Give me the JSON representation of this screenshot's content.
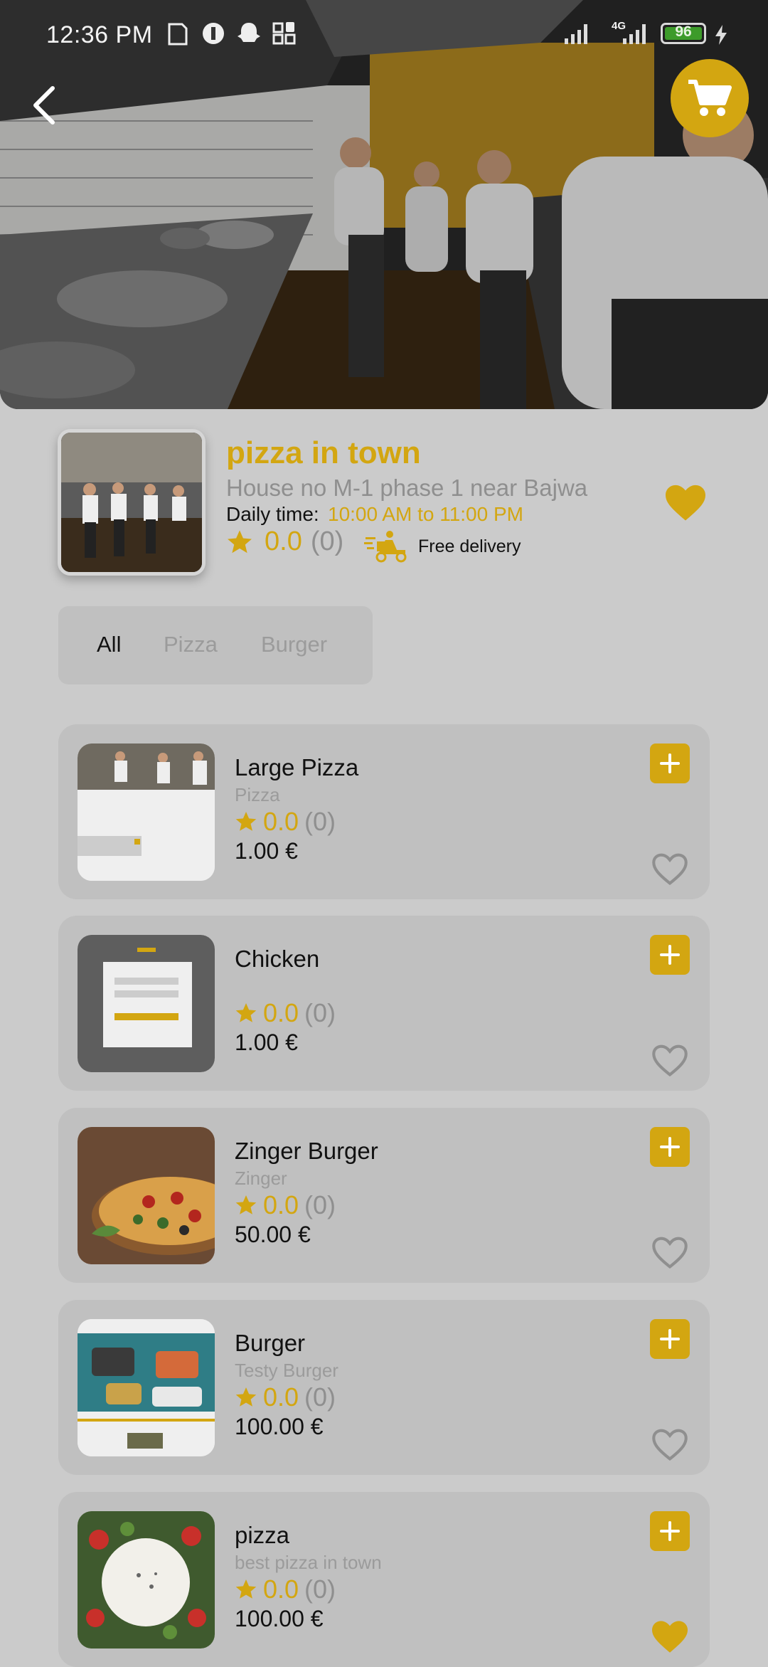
{
  "status_bar": {
    "time": "12:36 PM",
    "network": "4G",
    "battery": "96"
  },
  "header": {
    "back_icon": "chevron-left-icon",
    "cart_icon": "shopping-cart-icon"
  },
  "store": {
    "name": "pizza in town",
    "address": "House no M-1 phase 1 near Bajwa",
    "daily_time_label": "Daily time:",
    "daily_time_value": "10:00 AM to 11:00 PM",
    "rating": "0.0",
    "rating_count": "(0)",
    "delivery_text": "Free delivery",
    "favorite": true
  },
  "categories": [
    {
      "label": "All",
      "active": true
    },
    {
      "label": "Pizza",
      "active": false
    },
    {
      "label": "Burger",
      "active": false
    }
  ],
  "products": [
    {
      "name": "Large Pizza",
      "subtitle": "Pizza",
      "rating": "0.0",
      "rating_count": "(0)",
      "price": "1.00 €",
      "favorite": false
    },
    {
      "name": "Chicken",
      "subtitle": "",
      "rating": "0.0",
      "rating_count": "(0)",
      "price": "1.00 €",
      "favorite": false
    },
    {
      "name": "Zinger Burger",
      "subtitle": "Zinger",
      "rating": "0.0",
      "rating_count": "(0)",
      "price": "50.00 €",
      "favorite": false
    },
    {
      "name": "Burger",
      "subtitle": "Testy Burger",
      "rating": "0.0",
      "rating_count": "(0)",
      "price": "100.00 €",
      "favorite": false
    },
    {
      "name": "pizza",
      "subtitle": "best pizza in town",
      "rating": "0.0",
      "rating_count": "(0)",
      "price": "100.00 €",
      "favorite": true
    }
  ],
  "colors": {
    "accent": "#d3a611",
    "background": "#cbcbcb",
    "card": "#c0c0c0"
  }
}
